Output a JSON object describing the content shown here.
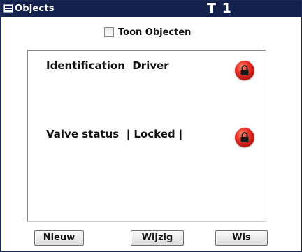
{
  "window": {
    "title": "Objects",
    "title_right": "T 1"
  },
  "filter": {
    "checkbox_label": "Toon Objecten",
    "checked": false
  },
  "objects": [
    {
      "label": "Identification  Driver",
      "icon": "lock-icon"
    },
    {
      "label": "Valve status  | Locked |",
      "icon": "lock-icon"
    }
  ],
  "buttons": {
    "new": "Nieuw",
    "edit": "Wijzig",
    "delete": "Wis"
  },
  "colors": {
    "titlebar": "#14214d",
    "lock": "#d8231c"
  }
}
